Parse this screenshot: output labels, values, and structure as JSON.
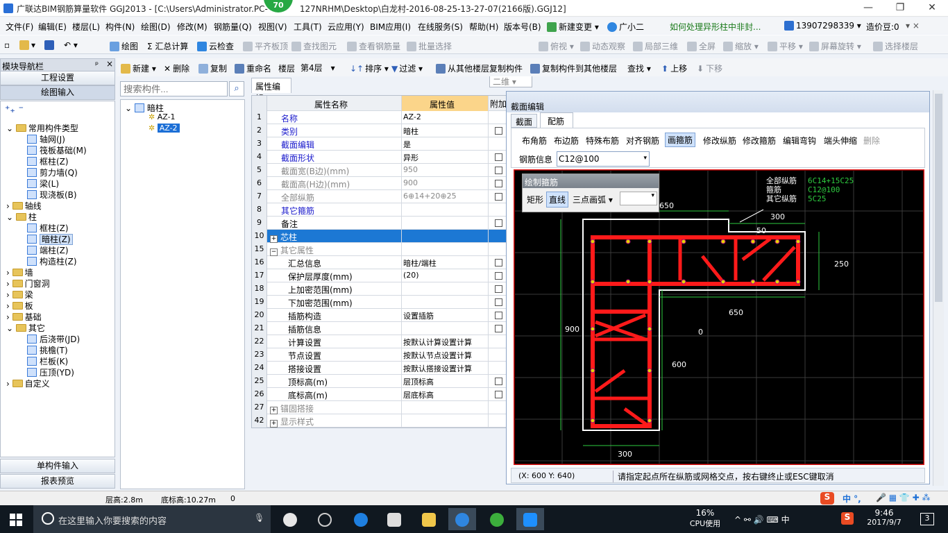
{
  "title": {
    "text": "广联达BIM钢筋算量软件 GGJ2013 - [C:\\Users\\Administrator.PC-",
    "text2": "127NRHM\\Desktop\\白龙村-2016-08-25-13-27-07(2166版).GGJ12]",
    "badge": "70"
  },
  "window_controls": {
    "minimize": "—",
    "restore": "❐",
    "close": "✕"
  },
  "menu": [
    "文件(F)",
    "编辑(E)",
    "楼层(L)",
    "构件(N)",
    "绘图(D)",
    "修改(M)",
    "钢筋量(Q)",
    "视图(V)",
    "工具(T)",
    "云应用(Y)",
    "BIM应用(I)",
    "在线服务(S)",
    "帮助(H)",
    "版本号(B)",
    "新建变更 ▾",
    "广小二",
    "如何处理异形柱中非封...",
    "13907298339 ▾",
    "造价豆:0"
  ],
  "toolbar1": [
    "绘图",
    "Σ 汇总计算",
    "云检查",
    "平齐板顶",
    "查找图元",
    "查看钢筋量",
    "批量选择",
    "二维",
    "俯视 ▾",
    "动态观察",
    "局部三维",
    "全屏",
    "缩放 ▾",
    "平移 ▾",
    "屏幕旋转 ▾",
    "选择楼层"
  ],
  "toolbar2": {
    "new": "新建 ▾",
    "delete": "删除",
    "copy": "复制",
    "rename": "重命名",
    "floor_label": "楼层",
    "floor_value": "第4层",
    "sort": "排序 ▾",
    "filter": "过滤 ▾",
    "copy_from": "从其他楼层复制构件",
    "copy_to": "复制构件到其他楼层",
    "find": "查找 ▾",
    "up": "上移",
    "down": "下移"
  },
  "nav": {
    "title": "模块导航栏",
    "pin": "ᵖ",
    "close": "×",
    "project_settings": "工程设置",
    "drawing_input": "绘图输入",
    "single_input": "单构件输入",
    "report_preview": "报表预览"
  },
  "navtree": [
    {
      "label": "常用构件类型",
      "lvl": 0,
      "type": "folder",
      "exp": "open"
    },
    {
      "label": "轴网(J)",
      "lvl": 1,
      "type": "comp"
    },
    {
      "label": "筏板基础(M)",
      "lvl": 1,
      "type": "comp"
    },
    {
      "label": "框柱(Z)",
      "lvl": 1,
      "type": "comp"
    },
    {
      "label": "剪力墙(Q)",
      "lvl": 1,
      "type": "comp"
    },
    {
      "label": "梁(L)",
      "lvl": 1,
      "type": "comp"
    },
    {
      "label": "现浇板(B)",
      "lvl": 1,
      "type": "comp"
    },
    {
      "label": "轴线",
      "lvl": 0,
      "type": "folder",
      "exp": "closed"
    },
    {
      "label": "柱",
      "lvl": 0,
      "type": "folder",
      "exp": "open"
    },
    {
      "label": "框柱(Z)",
      "lvl": 1,
      "type": "comp"
    },
    {
      "label": "暗柱(Z)",
      "lvl": 1,
      "type": "comp",
      "sel": true
    },
    {
      "label": "端柱(Z)",
      "lvl": 1,
      "type": "comp"
    },
    {
      "label": "构造柱(Z)",
      "lvl": 1,
      "type": "comp"
    },
    {
      "label": "墙",
      "lvl": 0,
      "type": "folder",
      "exp": "closed"
    },
    {
      "label": "门窗洞",
      "lvl": 0,
      "type": "folder",
      "exp": "closed"
    },
    {
      "label": "梁",
      "lvl": 0,
      "type": "folder",
      "exp": "closed"
    },
    {
      "label": "板",
      "lvl": 0,
      "type": "folder",
      "exp": "closed"
    },
    {
      "label": "基础",
      "lvl": 0,
      "type": "folder",
      "exp": "closed"
    },
    {
      "label": "其它",
      "lvl": 0,
      "type": "folder",
      "exp": "open"
    },
    {
      "label": "后浇带(JD)",
      "lvl": 1,
      "type": "comp"
    },
    {
      "label": "挑檐(T)",
      "lvl": 1,
      "type": "comp"
    },
    {
      "label": "栏板(K)",
      "lvl": 1,
      "type": "comp"
    },
    {
      "label": "压顶(YD)",
      "lvl": 1,
      "type": "comp"
    },
    {
      "label": "自定义",
      "lvl": 0,
      "type": "folder",
      "exp": "closed"
    }
  ],
  "search": {
    "placeholder": "搜索构件..."
  },
  "comptree": {
    "root": "暗柱",
    "items": [
      "AZ-1",
      "AZ-2"
    ]
  },
  "props": {
    "tab": "属性编辑",
    "col_name": "属性名称",
    "col_value": "属性值",
    "col_extra": "附加",
    "rows": [
      {
        "n": "1",
        "k": "名称",
        "v": "AZ-2",
        "s": "blue",
        "cb": false
      },
      {
        "n": "2",
        "k": "类别",
        "v": "暗柱",
        "s": "blue",
        "cb": true
      },
      {
        "n": "3",
        "k": "截面编辑",
        "v": "是",
        "s": "blue",
        "cb": false
      },
      {
        "n": "4",
        "k": "截面形状",
        "v": "异形",
        "s": "blue",
        "cb": true
      },
      {
        "n": "5",
        "k": "截面宽(B边)(mm)",
        "v": "950",
        "s": "gray",
        "cb": true
      },
      {
        "n": "6",
        "k": "截面高(H边)(mm)",
        "v": "900",
        "s": "gray",
        "cb": true
      },
      {
        "n": "7",
        "k": "全部纵筋",
        "v": "6⊕14+20⊕25",
        "s": "gray",
        "cb": true
      },
      {
        "n": "8",
        "k": "其它箍筋",
        "v": "",
        "s": "blue",
        "cb": false
      },
      {
        "n": "9",
        "k": "备注",
        "v": "",
        "s": "",
        "cb": true
      },
      {
        "n": "10",
        "k": "芯柱",
        "v": "",
        "s": "sel",
        "cb": false,
        "pm": "+"
      },
      {
        "n": "15",
        "k": "其它属性",
        "v": "",
        "s": "gray",
        "cb": false,
        "pm": "−"
      },
      {
        "n": "16",
        "k": "汇总信息",
        "v": "暗柱/端柱",
        "s": "sub",
        "cb": true
      },
      {
        "n": "17",
        "k": "保护层厚度(mm)",
        "v": "(20)",
        "s": "sub",
        "cb": true
      },
      {
        "n": "18",
        "k": "上加密范围(mm)",
        "v": "",
        "s": "sub",
        "cb": true
      },
      {
        "n": "19",
        "k": "下加密范围(mm)",
        "v": "",
        "s": "sub",
        "cb": true
      },
      {
        "n": "20",
        "k": "插筋构造",
        "v": "设置插筋",
        "s": "sub",
        "cb": true
      },
      {
        "n": "21",
        "k": "插筋信息",
        "v": "",
        "s": "sub",
        "cb": true
      },
      {
        "n": "22",
        "k": "计算设置",
        "v": "按默认计算设置计算",
        "s": "sub",
        "cb": false
      },
      {
        "n": "23",
        "k": "节点设置",
        "v": "按默认节点设置计算",
        "s": "sub",
        "cb": false
      },
      {
        "n": "24",
        "k": "搭接设置",
        "v": "按默认搭接设置计算",
        "s": "sub",
        "cb": false
      },
      {
        "n": "25",
        "k": "顶标高(m)",
        "v": "层顶标高",
        "s": "sub",
        "cb": true
      },
      {
        "n": "26",
        "k": "底标高(m)",
        "v": "层底标高",
        "s": "sub",
        "cb": true
      },
      {
        "n": "27",
        "k": "锚固搭接",
        "v": "",
        "s": "gray",
        "cb": false,
        "pm": "+"
      },
      {
        "n": "42",
        "k": "显示样式",
        "v": "",
        "s": "gray",
        "cb": false,
        "pm": "+"
      }
    ]
  },
  "section": {
    "title": "截面编辑",
    "tabs": [
      "截面",
      "配筋"
    ],
    "tools": [
      "布角筋",
      "布边筋",
      "特殊布筋",
      "对齐钢筋",
      "画箍筋",
      "修改纵筋",
      "修改箍筋",
      "编辑弯钩",
      "端头伸缩",
      "删除"
    ],
    "rebar_label": "钢筋信息",
    "rebar_value": "C12@100",
    "draw_title": "绘制箍筋",
    "draw_modes": [
      "矩形",
      "直线",
      "三点画弧 ▾"
    ],
    "info": [
      {
        "k": "全部纵筋",
        "v": "6C14+15C25"
      },
      {
        "k": "箍筋",
        "v": "C12@100"
      },
      {
        "k": "其它纵筋",
        "v": "5C25"
      }
    ],
    "dims": [
      "650",
      "300",
      "50",
      "250",
      "650",
      "900",
      "600",
      "300",
      "0"
    ],
    "coords": "(X: 600 Y: 640)",
    "hint": "请指定起点所在纵筋或网格交点，按右键终止或ESC键取消"
  },
  "status": {
    "floor_h": "层高:2.8m",
    "bottom": "底标高:10.27m",
    "zero": "0"
  },
  "ime": "中 °, ",
  "taskbar": {
    "search": "在这里输入你要搜索的内容",
    "cpu": "16%",
    "cpu_label": "CPU使用",
    "tray": "^ ⚯ 🔊 ⌨ 中",
    "time": "9:46",
    "date": "2017/9/7",
    "notif": "3"
  },
  "colors": {
    "rebar": "#ff1a1a",
    "dim": "#2ecc40",
    "canvas": "#000000",
    "accent": "#1c6fd6"
  }
}
